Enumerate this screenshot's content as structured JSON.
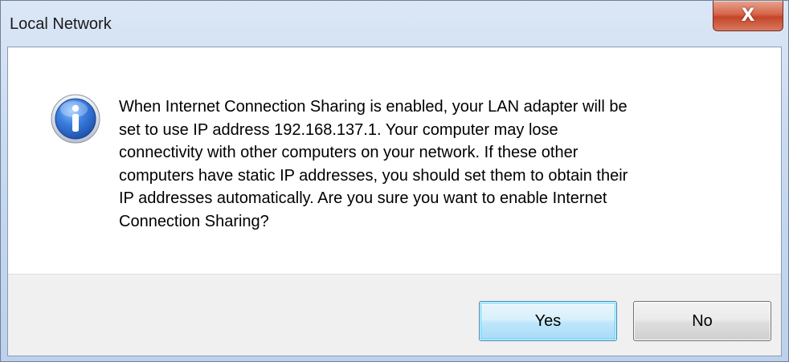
{
  "window": {
    "title": "Local Network",
    "close_label": "X"
  },
  "message": {
    "icon": "info-icon",
    "text": "When Internet Connection Sharing is enabled, your LAN adapter will be\nset to use IP address 192.168.137.1. Your computer may lose\nconnectivity with other computers on your network. If these other\ncomputers have static IP addresses, you should set them to obtain their\nIP addresses automatically.  Are you sure you want to enable Internet\nConnection Sharing?"
  },
  "buttons": {
    "yes_label": "Yes",
    "no_label": "No"
  },
  "colors": {
    "title_gradient_top": "#dbe7f6",
    "close_red": "#c4452a",
    "info_blue": "#2f6bd1",
    "default_button_border": "#3c7fb1"
  }
}
